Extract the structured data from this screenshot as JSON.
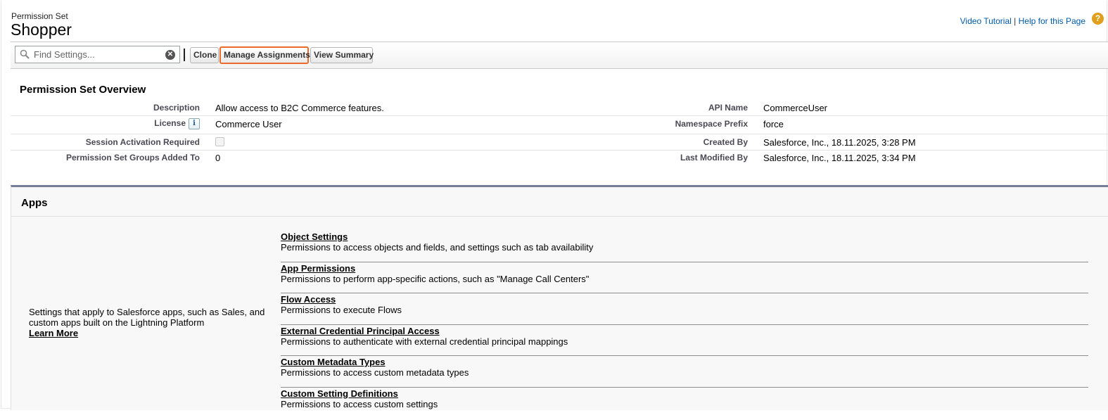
{
  "header": {
    "kicker": "Permission Set",
    "title": "Shopper",
    "video_tutorial": "Video Tutorial",
    "separator": " | ",
    "help_link": "Help for this Page",
    "help_icon": "?"
  },
  "toolbar": {
    "search_placeholder": "Find Settings...",
    "clone_label": "Clone",
    "manage_label": "Manage Assignments",
    "summary_label": "View Summary",
    "highlight_color": "#ec6a2c"
  },
  "overview": {
    "title": "Permission Set Overview",
    "rows": [
      {
        "label": "Description",
        "value": "Allow access to B2C Commerce features.",
        "right_label": "API Name",
        "right_value": "CommerceUser"
      },
      {
        "label": "License",
        "value": "Commerce User",
        "right_label": "Namespace Prefix",
        "right_value": "force"
      },
      {
        "label": "Session Activation Required",
        "value": "",
        "right_label": "Created By",
        "right_value": "Salesforce, Inc., 18.11.2025, 3:28 PM"
      },
      {
        "label": "Permission Set Groups Added To",
        "value": "0",
        "right_label": "Last Modified By",
        "right_value": "Salesforce, Inc., 18.11.2025, 3:34 PM"
      }
    ],
    "session_activation_checked": false,
    "info_icon": "i"
  },
  "apps": {
    "title": "Apps",
    "description": "Settings that apply to Salesforce apps, such as Sales, and custom apps built on the Lightning Platform",
    "learn_more": "Learn More",
    "items": [
      {
        "title": "Object Settings",
        "desc": "Permissions to access objects and fields, and settings such as tab availability"
      },
      {
        "title": "App Permissions",
        "desc": "Permissions to perform app-specific actions, such as \"Manage Call Centers\""
      },
      {
        "title": "Flow Access",
        "desc": "Permissions to execute Flows"
      },
      {
        "title": "External Credential Principal Access",
        "desc": "Permissions to authenticate with external credential principal mappings"
      },
      {
        "title": "Custom Metadata Types",
        "desc": "Permissions to access custom metadata types"
      },
      {
        "title": "Custom Setting Definitions",
        "desc": "Permissions to access custom settings"
      }
    ]
  }
}
